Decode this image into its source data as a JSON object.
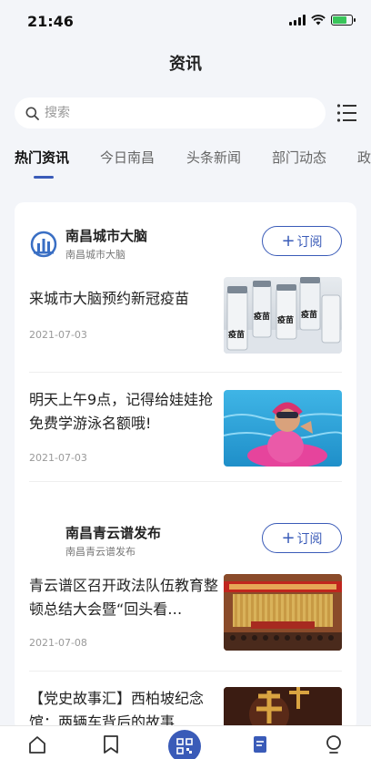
{
  "status_bar": {
    "time": "21:46"
  },
  "header": {
    "title": "资讯"
  },
  "search": {
    "placeholder": "搜索"
  },
  "tabs": [
    {
      "label": "热门资讯",
      "active": true
    },
    {
      "label": "今日南昌"
    },
    {
      "label": "头条新闻"
    },
    {
      "label": "部门动态"
    },
    {
      "label": "政"
    }
  ],
  "sources": [
    {
      "name": "南昌城市大脑",
      "subtitle": "南昌城市大脑",
      "subscribe_label": "订阅",
      "articles": [
        {
          "title": "来城市大脑预约新冠疫苗",
          "date": "2021-07-03",
          "image_label": "疫苗"
        },
        {
          "title": "明天上午9点，记得给娃娃抢免费学游泳名额哦!",
          "date": "2021-07-03"
        }
      ]
    },
    {
      "name": "南昌青云谱发布",
      "subtitle": "南昌青云谱发布",
      "subscribe_label": "订阅",
      "articles": [
        {
          "title": "青云谱区召开政法队伍教育整顿总结大会暨“回头看…",
          "date": "2021-07-08"
        },
        {
          "title": "【党史故事汇】西柏坡纪念馆：两辆车背后的故事"
        }
      ]
    }
  ],
  "colors": {
    "accent": "#3a5bb8",
    "background": "#f3f5f9"
  },
  "bottom_nav": [
    "home-icon",
    "bookmark-icon",
    "qr-scan-icon",
    "news-icon",
    "profile-icon"
  ]
}
